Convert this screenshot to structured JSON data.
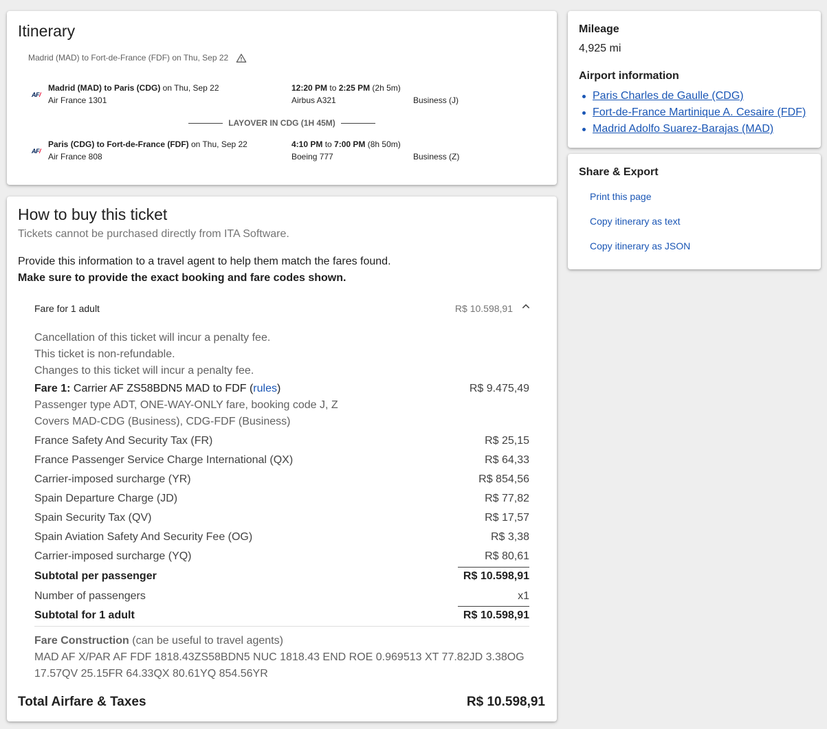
{
  "itinerary": {
    "title": "Itinerary",
    "summary": "Madrid (MAD) to Fort-de-France (FDF) on Thu, Sep 22",
    "warning_icon": "warning-icon",
    "segments": [
      {
        "airline_logo": "AF",
        "route": "Madrid (MAD) to Paris (CDG)",
        "date": " on Thu, Sep 22",
        "flight": "Air France 1301",
        "depart": "12:20 PM",
        "arrive": "2:25 PM",
        "to": " to ",
        "duration": " (2h 5m)",
        "aircraft": "Airbus A321",
        "cabin": "Business (J)"
      },
      {
        "airline_logo": "AF",
        "route": "Paris (CDG) to Fort-de-France (FDF)",
        "date": " on Thu, Sep 22",
        "flight": "Air France 808",
        "depart": "4:10 PM",
        "arrive": "7:00 PM",
        "to": " to ",
        "duration": " (8h 50m)",
        "aircraft": "Boeing 777",
        "cabin": "Business (Z)"
      }
    ],
    "layover": "LAYOVER IN CDG (1H 45M)"
  },
  "buy": {
    "title": "How to buy this ticket",
    "subtitle": "Tickets cannot be purchased directly from ITA Software.",
    "instructions": "Provide this information to a travel agent to help them match the fares found.",
    "instructions_bold": "Make sure to provide the exact booking and fare codes shown.",
    "fare_header_label": "Fare for 1 adult",
    "fare_header_value": "R$ 10.598,91",
    "notes": [
      "Cancellation of this ticket will incur a penalty fee.",
      "This ticket is non-refundable.",
      "Changes to this ticket will incur a penalty fee."
    ],
    "fare1_label": "Fare 1:",
    "fare1_text": " Carrier AF ZS58BDN5 MAD to FDF (",
    "fare1_rules": "rules",
    "fare1_close": ")",
    "fare1_value": "R$ 9.475,49",
    "fare1_detail1": "Passenger type ADT, ONE-WAY-ONLY fare, booking code J, Z",
    "fare1_detail2": "Covers MAD-CDG (Business), CDG-FDF (Business)",
    "taxes": [
      {
        "label": "France Safety And Security Tax (FR)",
        "value": "R$ 25,15"
      },
      {
        "label": "France Passenger Service Charge International (QX)",
        "value": "R$ 64,33"
      },
      {
        "label": "Carrier-imposed surcharge (YR)",
        "value": "R$ 854,56"
      },
      {
        "label": "Spain Departure Charge (JD)",
        "value": "R$ 77,82"
      },
      {
        "label": "Spain Security Tax (QV)",
        "value": "R$ 17,57"
      },
      {
        "label": "Spain Aviation Safety And Security Fee (OG)",
        "value": "R$ 3,38"
      },
      {
        "label": "Carrier-imposed surcharge (YQ)",
        "value": "R$ 80,61"
      }
    ],
    "subtotal_label": "Subtotal per passenger",
    "subtotal_value": "R$ 10.598,91",
    "passengers_label": "Number of passengers",
    "passengers_value": "x1",
    "subtotal_adult_label": "Subtotal for 1 adult",
    "subtotal_adult_value": "R$ 10.598,91",
    "construction_label": "Fare Construction",
    "construction_note": " (can be useful to travel agents)",
    "construction_line1": "MAD AF X/PAR AF FDF 1818.43ZS58BDN5 NUC 1818.43 END ROE 0.969513 XT 77.82JD 3.38OG",
    "construction_line2": "17.57QV 25.15FR 64.33QX 80.61YQ 854.56YR",
    "total_label": "Total Airfare & Taxes",
    "total_value": "R$ 10.598,91"
  },
  "mileage": {
    "title": "Mileage",
    "value": "4,925 mi",
    "airport_title": "Airport information",
    "airports": [
      "Paris Charles de Gaulle (CDG)",
      "Fort-de-France Martinique A. Cesaire (FDF)",
      "Madrid Adolfo Suarez-Barajas (MAD)"
    ]
  },
  "share": {
    "title": "Share & Export",
    "links": [
      "Print this page",
      "Copy itinerary as text",
      "Copy itinerary as JSON"
    ]
  },
  "colors": {
    "link": "#1a56b5",
    "background": "#eeeeee",
    "airline_red": "#e4002b",
    "airline_blue": "#002157"
  }
}
